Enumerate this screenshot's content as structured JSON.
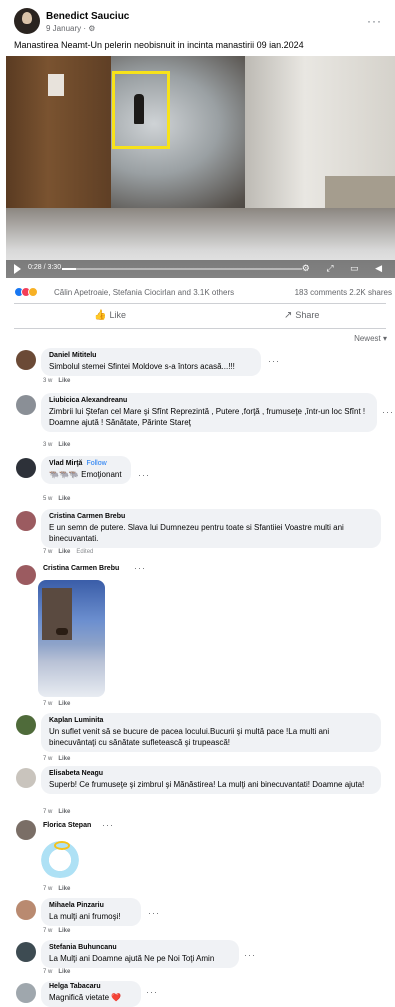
{
  "post": {
    "author": "Benedict Sauciuc",
    "meta": "9 January · ⚙",
    "text": "Manastirea Neamt-Un pelerin neobisnuit in incinta manastirii  09 ian.2024",
    "more": "···"
  },
  "video": {
    "time": "0:28 / 3:30",
    "progress": 0.06,
    "icons": "⚙ ⤢ ▭ ◀"
  },
  "reactions": {
    "names": "Călin Apetroaie, Stefania Ciocirlan and 3.1K others",
    "stats": "183 comments  2.2K shares"
  },
  "actions": {
    "like": "Like",
    "share": "Share",
    "like_icon": "👍",
    "share_icon": "↗"
  },
  "sort": "Newest ▾",
  "comments": [
    {
      "name": "Daniel Mititelu",
      "text": "Simbolul stemei Sfintei Moldove s-a întors acasă...!!!",
      "time": "3 w",
      "like": "Like"
    },
    {
      "name": "Liubicica Alexandreanu",
      "text": "Zimbrii lui Ştefan cel Mare şi Sfînt Reprezintă , Putere ,forţă , frumuseţe ,într-un loc Sfînt ! Doamne ajută ! Sănătate, Părinte Stareţ",
      "time": "3 w",
      "like": "Like"
    },
    {
      "name": "Vlad Mirţă",
      "follow": "Follow",
      "text": "🐃🐃🐃 Emoţionant",
      "time": "5 w",
      "like": "Like"
    },
    {
      "name": "Cristina Carmen Brebu",
      "text": "E un semn de putere. Slava lui Dumnezeu pentru toate si Sfantiiei Voastre multi ani binecuvantati.",
      "time": "7 w",
      "like": "Like",
      "edited": "Edited"
    },
    {
      "name": "Cristina Carmen Brebu",
      "time": "7 w",
      "like": "Like"
    },
    {
      "name": "Kaplan Luminita",
      "text": "Un suflet venit să se bucure de pacea locului.Bucurii şi multă pace !La multi ani binecuvântaţi cu sănătate sufletească şi trupească!",
      "time": "7 w",
      "like": "Like"
    },
    {
      "name": "Elisabeta Neagu",
      "text": "Superb! Ce frumuseţe şi zimbrul şi Mănăstirea! La mulţi ani binecuvantati! Doamne ajuta!",
      "time": "7 w",
      "like": "Like"
    },
    {
      "name": "Florica Stepan",
      "time": "7 w",
      "like": "Like"
    },
    {
      "name": "Mihaela Pinzariu",
      "text": "La mulţi ani frumoşi!",
      "time": "7 w",
      "like": "Like"
    },
    {
      "name": "Stefania Buhuncanu",
      "text": "La Mulţi ani Doamne ajută Ne pe Noi Toţi Amin",
      "time": "7 w",
      "like": "Like"
    },
    {
      "name": "Helga Tabacaru",
      "text": "Magnifică vietate ❤️"
    }
  ],
  "colors": {
    "avatar1": "#6b4a36",
    "avatar2": "#8a8f96",
    "avatar3": "#2d3139",
    "avatar4": "#9b5b60",
    "avatar5": "#4f6b3a",
    "avatar6": "#c9c4bd",
    "avatar7": "#7a6e66",
    "avatar8": "#b98a70",
    "avatar9": "#3d4b52",
    "avatar10": "#9fa7ad"
  }
}
